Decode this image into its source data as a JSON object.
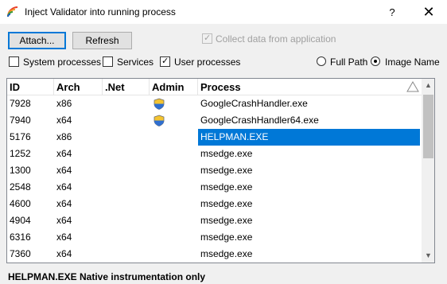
{
  "window": {
    "title": "Inject Validator into running process",
    "help_label": "?",
    "close_label": "✕"
  },
  "toolbar": {
    "attach_label": "Attach...",
    "refresh_label": "Refresh",
    "collect_label": "Collect data from application"
  },
  "filters": {
    "system_label": "System processes",
    "services_label": "Services",
    "user_label": "User processes",
    "full_path_label": "Full Path",
    "image_name_label": "Image Name",
    "check_mark": "✓"
  },
  "columns": {
    "id": "ID",
    "arch": "Arch",
    "net": ".Net",
    "admin": "Admin",
    "process": "Process"
  },
  "rows": [
    {
      "id": "7928",
      "arch": "x86",
      "process": "GoogleCrashHandler.exe",
      "admin": true
    },
    {
      "id": "7940",
      "arch": "x64",
      "process": "GoogleCrashHandler64.exe",
      "admin": true
    },
    {
      "id": "5176",
      "arch": "x86",
      "process": "HELPMAN.EXE",
      "admin": false
    },
    {
      "id": "1252",
      "arch": "x64",
      "process": "msedge.exe",
      "admin": false
    },
    {
      "id": "1300",
      "arch": "x64",
      "process": "msedge.exe",
      "admin": false
    },
    {
      "id": "2548",
      "arch": "x64",
      "process": "msedge.exe",
      "admin": false
    },
    {
      "id": "4600",
      "arch": "x64",
      "process": "msedge.exe",
      "admin": false
    },
    {
      "id": "4904",
      "arch": "x64",
      "process": "msedge.exe",
      "admin": false
    },
    {
      "id": "6316",
      "arch": "x64",
      "process": "msedge.exe",
      "admin": false
    },
    {
      "id": "7360",
      "arch": "x64",
      "process": "msedge.exe",
      "admin": false
    }
  ],
  "status": {
    "text": "HELPMAN.EXE Native instrumentation only"
  }
}
